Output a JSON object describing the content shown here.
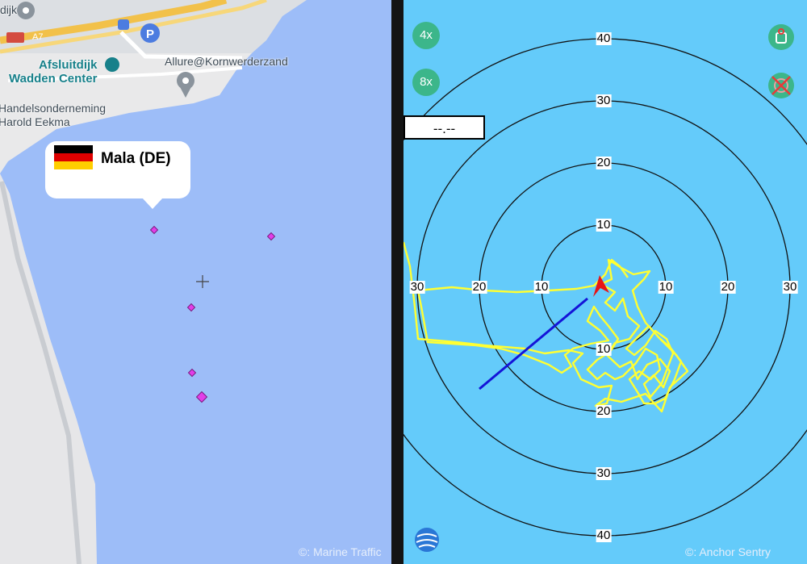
{
  "left_map": {
    "labels": {
      "road": "A7",
      "poi_line1": "Afsluitdijk",
      "poi_line2": "Wadden Center",
      "allure": "Allure@Kornwerderzand",
      "company_line1": "Handelsonderneming",
      "company_line2": "Harold Eekma",
      "dijk": "dijk"
    },
    "vessel": {
      "name": "Mala (DE)",
      "flag_colors": [
        "#000000",
        "#dd0000",
        "#ffce00"
      ]
    },
    "credit": "©: Marine Traffic",
    "colors": {
      "water": "#9dbdf8",
      "land": "#dcdfe3",
      "road": "#f5c94a",
      "marker": "#e23ee8"
    }
  },
  "right_panel": {
    "zoom_buttons": [
      "4x",
      "8x"
    ],
    "readout": "--.--",
    "ring_labels": [
      "10",
      "20",
      "30",
      "40"
    ],
    "credit": "©: Anchor Sentry",
    "icons": [
      "anchor-alarm-icon",
      "gps-off-icon",
      "globe-icon"
    ],
    "colors": {
      "background": "#64cbfa",
      "track": "#ffff33",
      "bearing": "#1414d8",
      "boat": "#e81414",
      "button": "#3cb68a"
    }
  }
}
